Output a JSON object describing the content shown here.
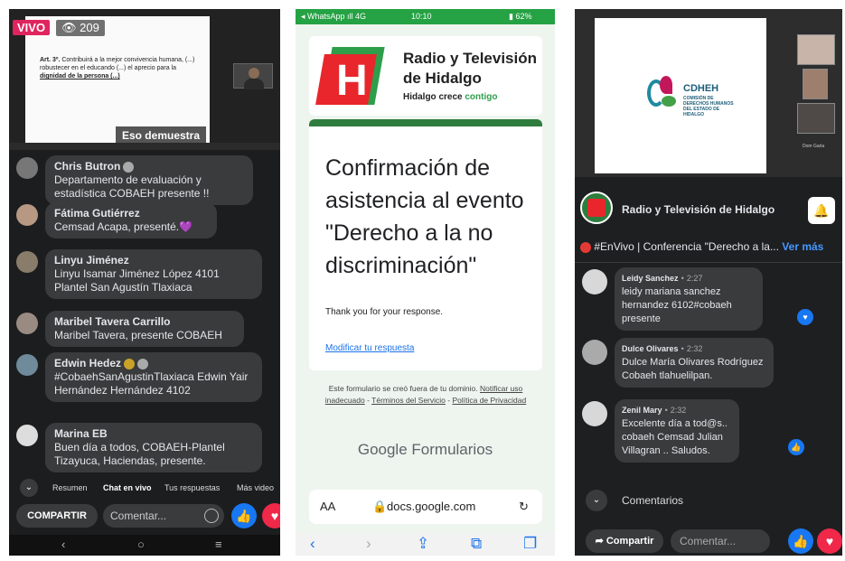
{
  "panel1": {
    "live_badge": "VIVO",
    "viewers": "209",
    "slide_text_prefix": "Art. 3º.",
    "slide_text": "Contribuirá a la mejor convivencia humana, (...) robustecer en el educando (...) el aprecio para la",
    "slide_text_emph": "dignidad de la persona (...)",
    "caption": "Eso demuestra",
    "comments": [
      {
        "name": "Chris Butron",
        "text": "Departamento de evaluación y estadística COBAEH presente !!"
      },
      {
        "name": "Fátima Gutiérrez",
        "text": "Cemsad Acapa, presenté.💜"
      },
      {
        "name": "Linyu Jiménez",
        "text": "Linyu Isamar Jiménez López 4101 Plantel San Agustín Tlaxiaca"
      },
      {
        "name": "Maribel Tavera Carrillo",
        "text": "Maribel Tavera, presente COBAEH"
      },
      {
        "name": "Edwin Hedez",
        "text": "#CobaehSanAgustinTlaxiaca Edwin Yair Hernández Hernández 4102"
      },
      {
        "name": "Marina EB",
        "text": "Buen día a todos, COBAEH-Plantel Tizayuca, Haciendas, presente."
      }
    ],
    "tabs": [
      "Resumen",
      "Chat en vivo",
      "Tus respuestas",
      "Más video"
    ],
    "share_label": "COMPARTIR",
    "comment_placeholder": "Comentar...",
    "nav": [
      "‹",
      "○",
      "≡"
    ]
  },
  "panel2": {
    "status_left": "◂ WhatsApp ıll 4G",
    "status_time": "10:10",
    "status_battery": "▮ 62%",
    "brand_line1": "Radio y Televisión",
    "brand_line2": "de Hidalgo",
    "brand_slogan_a": "Hidalgo crece",
    "brand_slogan_b": "contigo",
    "logo_letter": "H",
    "form_title": "Confirmación de asistencia al evento \"Derecho a la no discriminación\"",
    "thanks": "Thank you for your response.",
    "edit_link": "Modificar tu respuesta",
    "footer_text": "Este formulario se creó fuera de tu dominio.",
    "footer_links": [
      "Notificar uso inadecuado",
      "Términos del Servicio",
      "Política de Privacidad"
    ],
    "google_label": "Google",
    "forms_label": "Formularios",
    "url_aa": "AA",
    "url": "docs.google.com",
    "reload_icon": "↻",
    "bottom_icons": [
      "‹",
      "›",
      "⇪",
      "⧉",
      "❐"
    ]
  },
  "panel3": {
    "logo_title": "CDHEH",
    "logo_sub": "COMISIÓN DE DERECHOS HUMANOS DEL ESTADO DE HIDALGO",
    "thumb_name": "Dom Garia",
    "page_name": "Radio y Televisión de Hidalgo",
    "live_text": "#EnVivo | Conferencia \"Derecho a la...",
    "see_more": "Ver más",
    "comments": [
      {
        "name": "Leidy Sanchez",
        "time": "2:27",
        "text": "leidy mariana sanchez hernandez 6102#cobaeh presente"
      },
      {
        "name": "Dulce Olivares",
        "time": "2:32",
        "text": "Dulce María Olivares Rodríguez Cobaeh tlahuelilpan."
      },
      {
        "name": "Zenil Mary",
        "time": "2:32",
        "text": "Excelente día a tod@s.. cobaeh Cemsad Julian Villagran .. Saludos."
      }
    ],
    "comments_label": "Comentarios",
    "share_label": "Compartir",
    "comment_placeholder": "Comentar..."
  }
}
